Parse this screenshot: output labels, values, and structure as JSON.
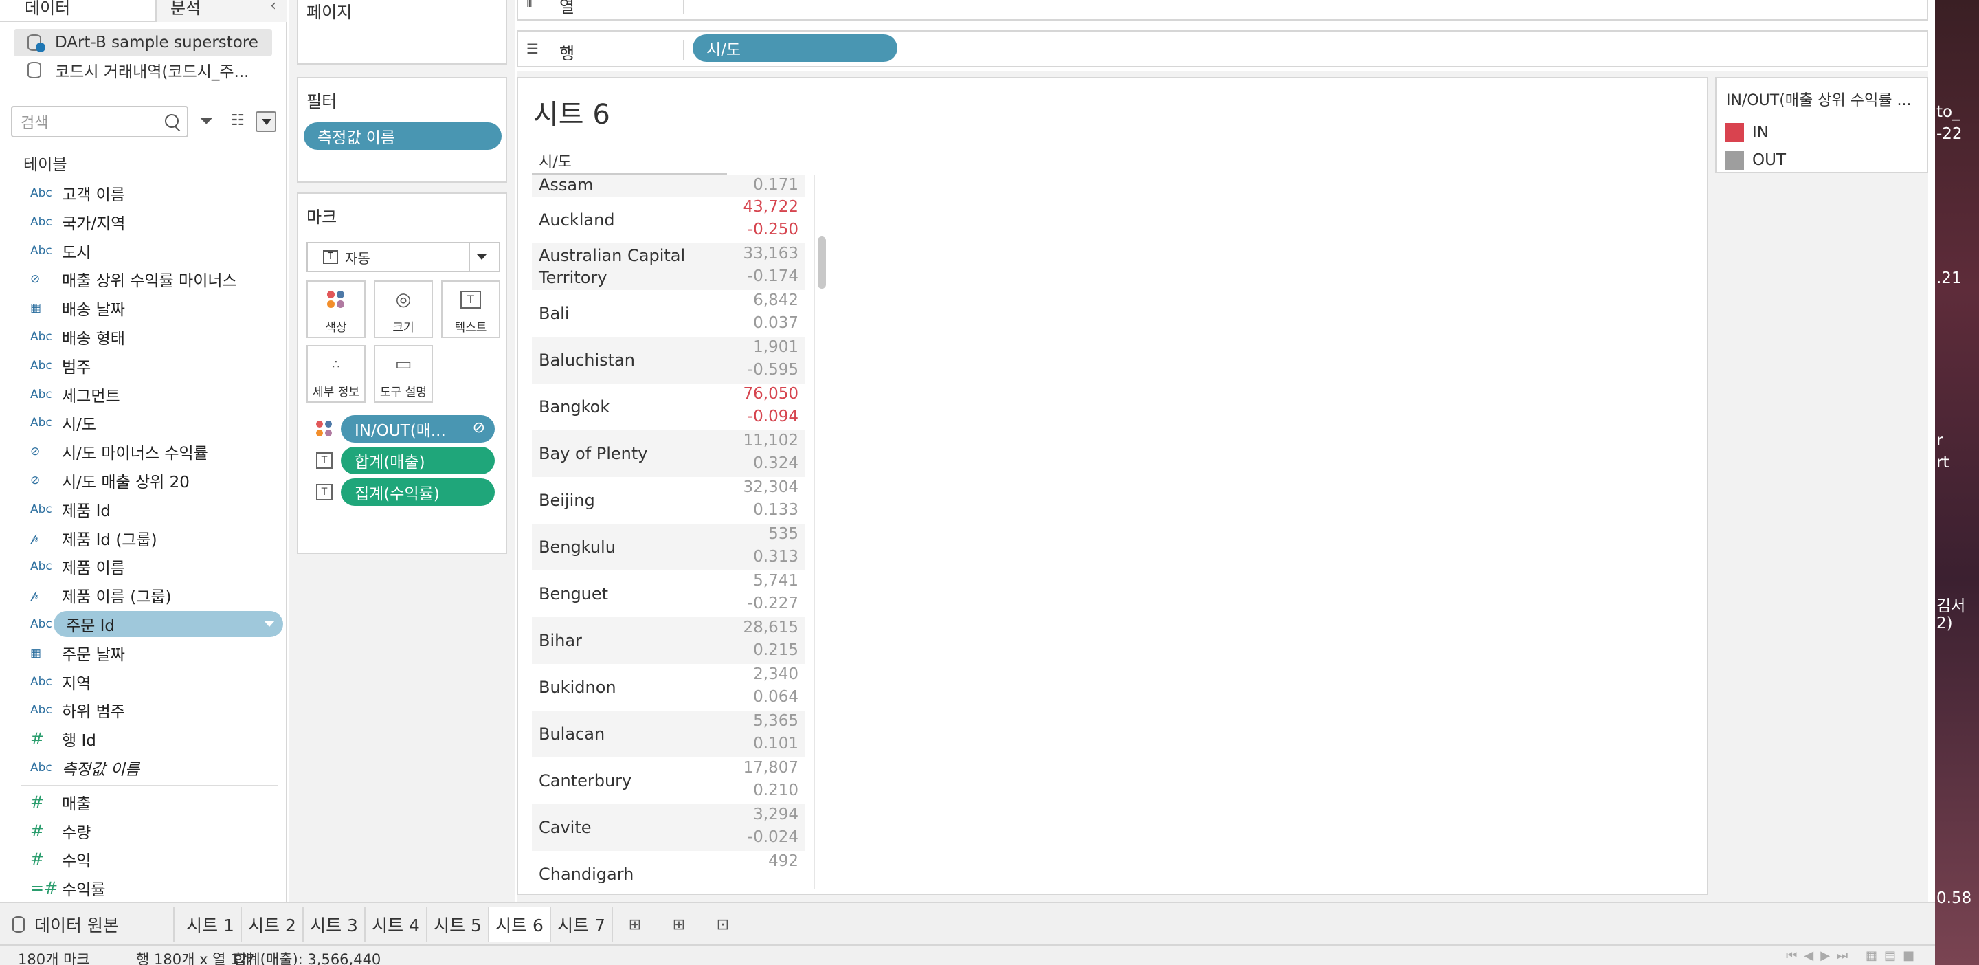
{
  "left_pane": {
    "tabs": {
      "data": "데이터",
      "analysis": "분석"
    },
    "datasources": [
      "DArt-B sample superstore",
      "코드시 거래내역(코드시_주..."
    ],
    "search_placeholder": "검색",
    "tables_label": "테이블",
    "fields": [
      {
        "type": "Abc",
        "label": "고객 이름"
      },
      {
        "type": "Abc",
        "label": "국가/지역"
      },
      {
        "type": "Abc",
        "label": "도시"
      },
      {
        "type": "set",
        "label": "매출 상위 수익률 마이너스"
      },
      {
        "type": "date",
        "label": "배송 날짜"
      },
      {
        "type": "Abc",
        "label": "배송 형태"
      },
      {
        "type": "Abc",
        "label": "범주"
      },
      {
        "type": "Abc",
        "label": "세그먼트"
      },
      {
        "type": "Abc",
        "label": "시/도"
      },
      {
        "type": "set",
        "label": "시/도 마이너스 수익률"
      },
      {
        "type": "set",
        "label": "시/도 매출 상위 20"
      },
      {
        "type": "Abc",
        "label": "제품 Id"
      },
      {
        "type": "group",
        "label": "제품 Id (그룹)"
      },
      {
        "type": "Abc",
        "label": "제품 이름"
      },
      {
        "type": "group",
        "label": "제품 이름 (그룹)"
      },
      {
        "type": "Abc",
        "label": "주문 Id"
      },
      {
        "type": "date",
        "label": "주문 날짜"
      },
      {
        "type": "Abc",
        "label": "지역"
      },
      {
        "type": "Abc",
        "label": "하위 범주"
      },
      {
        "type": "#",
        "label": "행 Id"
      },
      {
        "type": "Abc",
        "label": "측정값 이름"
      }
    ],
    "measures": [
      {
        "type": "#",
        "label": "매출"
      },
      {
        "type": "#",
        "label": "수량"
      },
      {
        "type": "#",
        "label": "수익"
      },
      {
        "type": "=#",
        "label": "수익률"
      }
    ]
  },
  "mid_pane": {
    "pages_title": "페이지",
    "filters_title": "필터",
    "filter_pill": "측정값 이름",
    "marks_title": "마크",
    "mark_type": "자동",
    "mark_buttons": [
      "색상",
      "크기",
      "텍스트",
      "세부 정보",
      "도구 설명"
    ],
    "encodings": [
      "IN/OUT(매...",
      "합계(매출)",
      "집계(수익률)"
    ]
  },
  "shelves": {
    "columns": "열",
    "rows": "행",
    "rows_pill": "시/도"
  },
  "sheet": {
    "title": "시트 6",
    "column_header": "시/도",
    "rows": [
      {
        "name": "Assam",
        "v1": "",
        "v2": "0.171",
        "in": false
      },
      {
        "name": "Auckland",
        "v1": "43,722",
        "v2": "-0.250",
        "in": true
      },
      {
        "name": "Australian Capital Territory",
        "v1": "33,163",
        "v2": "-0.174",
        "in": false
      },
      {
        "name": "Bali",
        "v1": "6,842",
        "v2": "0.037",
        "in": false
      },
      {
        "name": "Baluchistan",
        "v1": "1,901",
        "v2": "-0.595",
        "in": false
      },
      {
        "name": "Bangkok",
        "v1": "76,050",
        "v2": "-0.094",
        "in": true
      },
      {
        "name": "Bay of Plenty",
        "v1": "11,102",
        "v2": "0.324",
        "in": false
      },
      {
        "name": "Beijing",
        "v1": "32,304",
        "v2": "0.133",
        "in": false
      },
      {
        "name": "Bengkulu",
        "v1": "535",
        "v2": "0.313",
        "in": false
      },
      {
        "name": "Benguet",
        "v1": "5,741",
        "v2": "-0.227",
        "in": false
      },
      {
        "name": "Bihar",
        "v1": "28,615",
        "v2": "0.215",
        "in": false
      },
      {
        "name": "Bukidnon",
        "v1": "2,340",
        "v2": "0.064",
        "in": false
      },
      {
        "name": "Bulacan",
        "v1": "5,365",
        "v2": "0.101",
        "in": false
      },
      {
        "name": "Canterbury",
        "v1": "17,807",
        "v2": "0.210",
        "in": false
      },
      {
        "name": "Cavite",
        "v1": "3,294",
        "v2": "-0.024",
        "in": false
      },
      {
        "name": "Chandigarh",
        "v1": "492",
        "v2": "",
        "in": false
      }
    ]
  },
  "legend": {
    "title": "IN/OUT(매출 상위 수익률 ...",
    "items": [
      {
        "label": "IN",
        "color": "#d9434f"
      },
      {
        "label": "OUT",
        "color": "#9e9e9e"
      }
    ]
  },
  "desktop_fragments": [
    "to_",
    "-22",
    ".21",
    "r",
    "rt",
    "김서",
    "2)",
    "0.58"
  ],
  "bottom_tabs": {
    "source": "데이터 원본",
    "sheets": [
      "시트 1",
      "시트 2",
      "시트 3",
      "시트 4",
      "시트 5",
      "시트 6",
      "시트 7"
    ],
    "active": "시트 6"
  },
  "status": {
    "marks": "180개 마크",
    "dims": "행 180개 x 열 1개",
    "sum": "합계(매출): 3,566,440"
  },
  "colors": {
    "in": "#d6454f",
    "out_text": "#9a9a9a",
    "pill_blue": "#4996b2",
    "pill_green": "#1fa67a"
  }
}
